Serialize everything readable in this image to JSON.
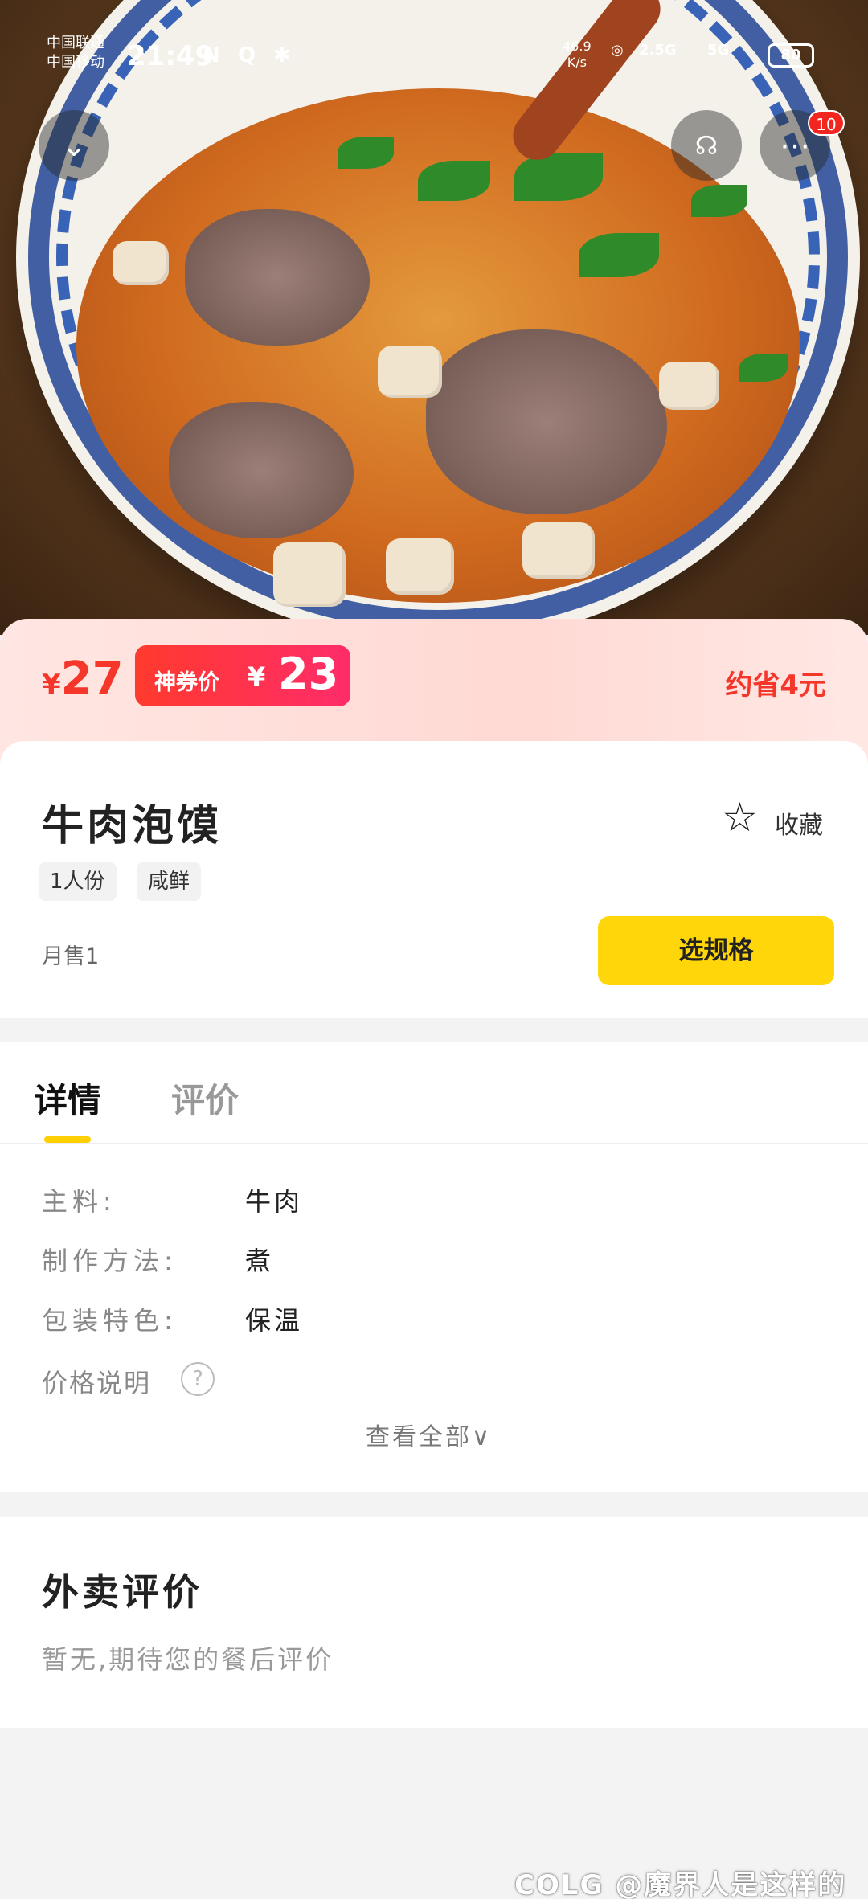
{
  "status_bar": {
    "carrier1": "中国联通",
    "carrier2": "中国移动",
    "time": "21:49",
    "speed_value": "46.9",
    "speed_unit": "K/s",
    "net1": "2.5G",
    "net2": "5G",
    "battery": "80"
  },
  "nav": {
    "back_icon": "chevron-down-icon",
    "service_icon": "customer-service-icon",
    "more_icon": "more-icon",
    "more_badge": "10"
  },
  "price": {
    "currency": "¥",
    "original": "27",
    "coupon_label": "神券价",
    "coupon_price": "23",
    "save_text": "约省4元"
  },
  "product": {
    "name": "牛肉泡馍",
    "favorite_label": "收藏",
    "tags": [
      "1人份",
      "咸鲜"
    ],
    "monthly_sales": "月售1",
    "select_spec_label": "选规格"
  },
  "tabs": [
    {
      "label": "详情",
      "active": true
    },
    {
      "label": "评价",
      "active": false
    }
  ],
  "details": {
    "rows": [
      {
        "label": "主料:",
        "value": "牛肉"
      },
      {
        "label": "制作方法:",
        "value": "煮"
      },
      {
        "label": "包装特色:",
        "value": "保温"
      }
    ],
    "price_note_label": "价格说明",
    "see_all": "查看全部∨"
  },
  "reviews": {
    "title": "外卖评价",
    "empty_text": "暂无,期待您的餐后评价"
  },
  "watermark": "COLG @魔界人是这样的"
}
